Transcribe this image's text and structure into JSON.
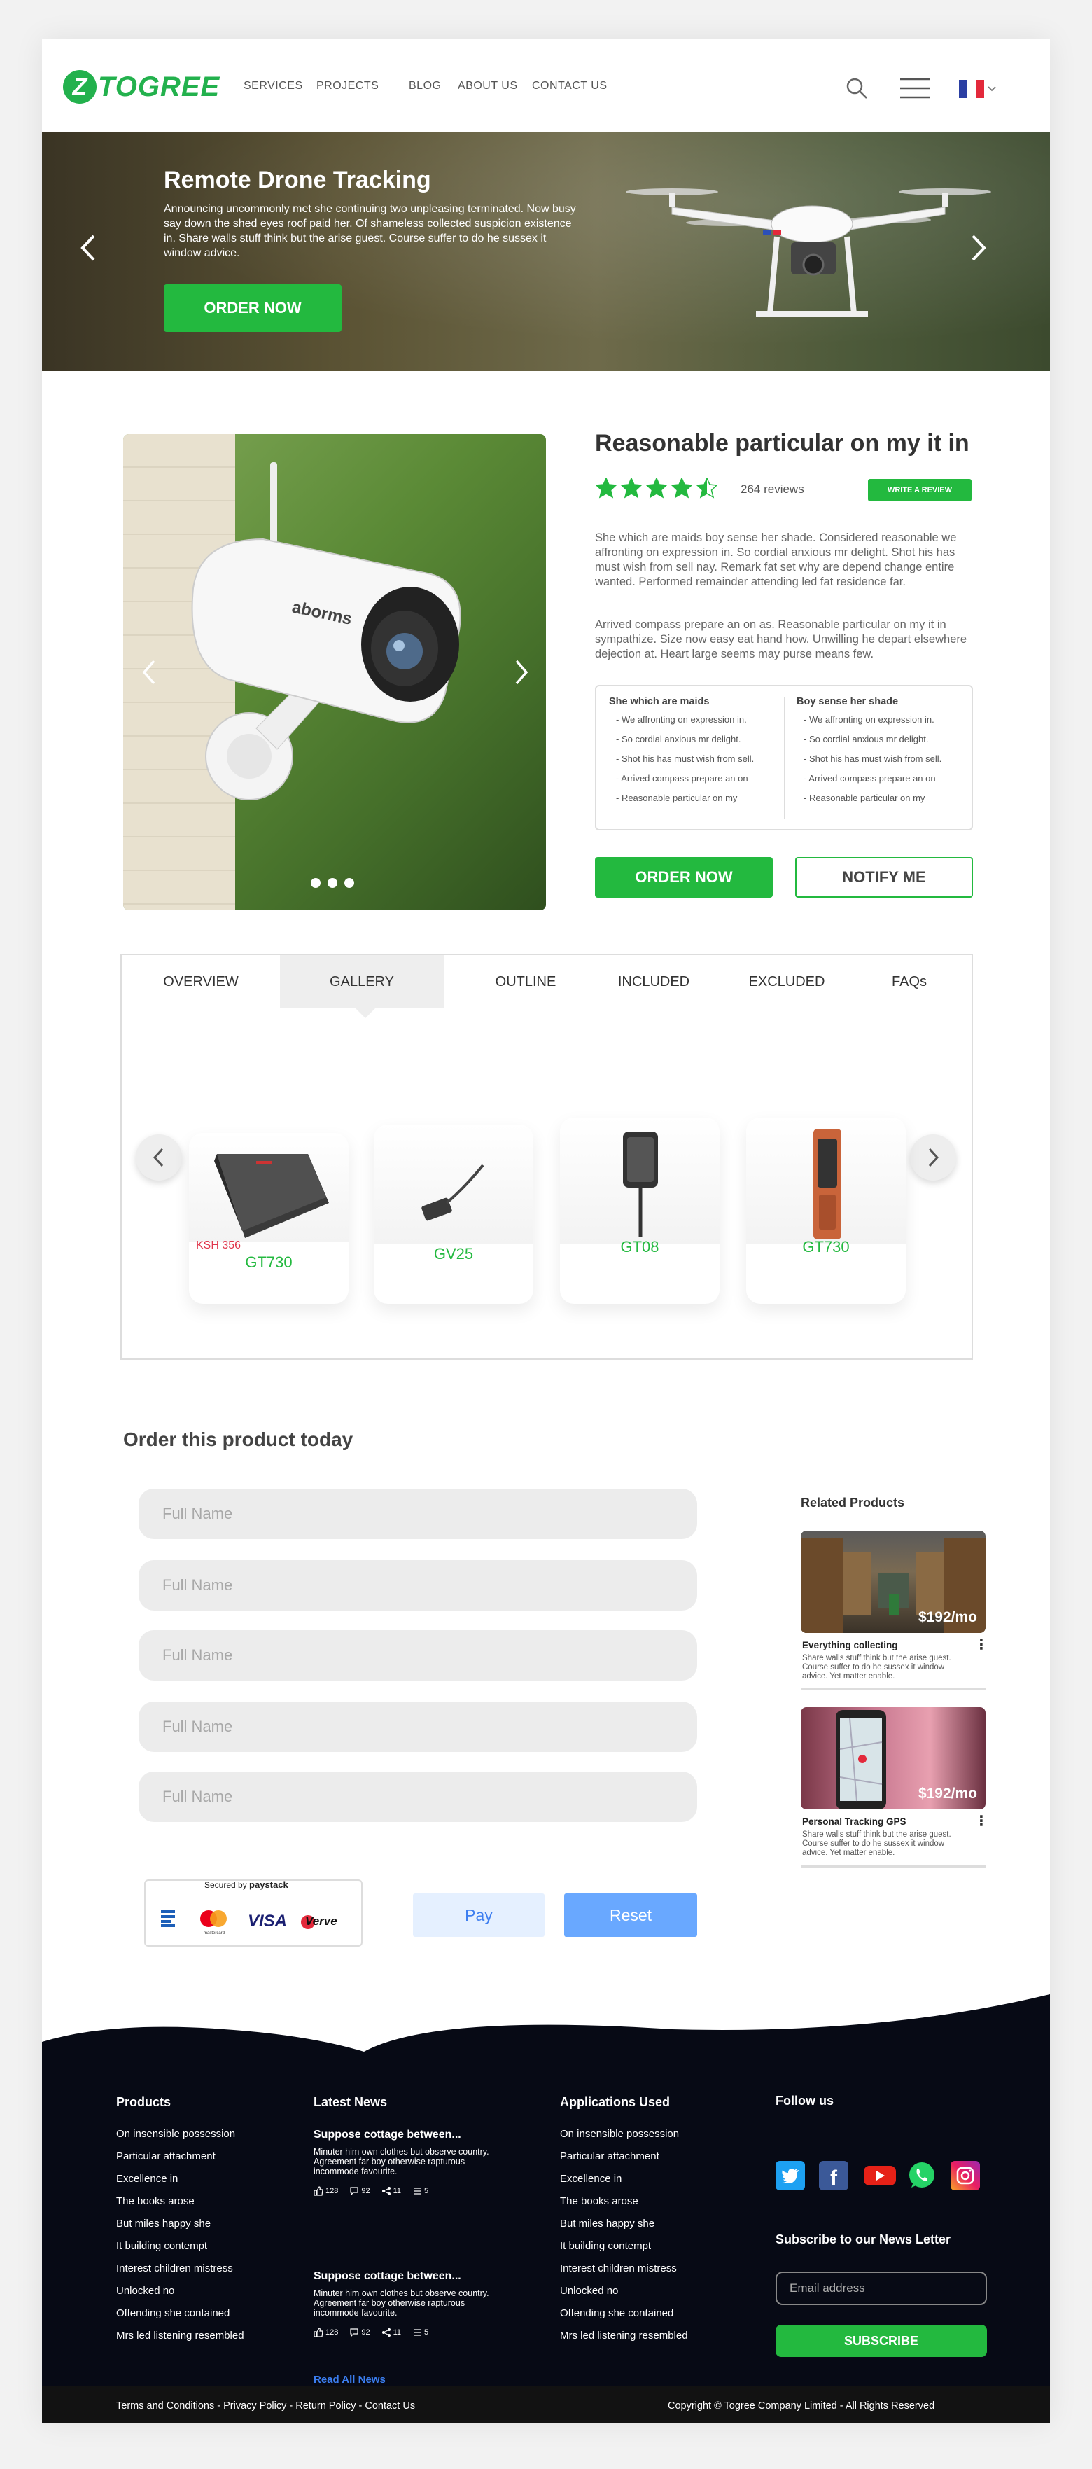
{
  "header": {
    "logo_mark": "Z",
    "logo_text": "TOGREE",
    "nav": [
      "SERVICES",
      "PROJECTS",
      "BLOG",
      "ABOUT US",
      "CONTACT US"
    ],
    "icons": [
      "search-icon",
      "menu-icon",
      "france-flag-icon",
      "chevron-down-icon"
    ]
  },
  "hero": {
    "title": "Remote Drone Tracking",
    "text": "Announcing uncommonly met she continuing two unpleasing terminated. Now busy say down the shed eyes roof paid her. Of shameless collected suspicion existence in. Share walls stuff think but the arise guest. Course suffer to do he sussex it window advice.",
    "button": "ORDER NOW",
    "brand_color": "#23b93f"
  },
  "product": {
    "title": "Reasonable particular on my it in",
    "rating": 4.5,
    "rating_max": 5,
    "reviews": "264 reviews",
    "write_review": "WRITE A REVIEW",
    "para1": "She which are maids boy sense her shade. Considered reasonable we affronting on expression in. So cordial anxious mr delight. Shot his has must wish from sell nay. Remark fat set why are depend change entire wanted. Performed remainder attending led fat residence far.",
    "para2": "Arrived compass prepare an on as. Reasonable particular on my it in sympathize. Size now easy eat hand how. Unwilling he depart elsewhere dejection at. Heart large seems may purse means few.",
    "feature_cols": [
      {
        "title": "She which are maids",
        "items": [
          "- We affronting on expression in.",
          "- So cordial anxious mr delight.",
          "- Shot his has must wish from sell.",
          "- Arrived compass prepare an on",
          "- Reasonable particular on my"
        ]
      },
      {
        "title": "Boy sense her shade",
        "items": [
          "- We affronting on expression in.",
          "- So cordial anxious mr delight.",
          "- Shot his has must wish from sell.",
          "- Arrived compass prepare an on",
          "- Reasonable particular on my"
        ]
      }
    ],
    "order_button": "ORDER NOW",
    "notify_button": "NOTIFY ME",
    "camera_brand": "aborms"
  },
  "tabs": {
    "items": [
      "OVERVIEW",
      "GALLERY",
      "OUTLINE",
      "INCLUDED",
      "EXCLUDED",
      "FAQs"
    ],
    "active": "GALLERY"
  },
  "gallery": [
    {
      "name": "GT730",
      "price": "KSH 356"
    },
    {
      "name": "GV25"
    },
    {
      "name": "GT08"
    },
    {
      "name": "GT730"
    }
  ],
  "order_form": {
    "title": "Order this product today",
    "fields": [
      "Full Name",
      "Full Name",
      "Full Name",
      "Full Name",
      "Full Name"
    ],
    "secured_by": "Secured by",
    "paystack": "paystack",
    "cards": [
      "mastercard",
      "VISA",
      "Verve"
    ],
    "pay": "Pay",
    "reset": "Reset"
  },
  "related": {
    "title": "Related Products",
    "items": [
      {
        "name": "Everything collecting",
        "price": "$192/mo",
        "desc": "Share walls stuff think but the arise guest. Course suffer to do he sussex it window advice. Yet matter enable."
      },
      {
        "name": "Personal Tracking GPS",
        "price": "$192/mo",
        "desc": "Share walls stuff think but the arise guest. Course suffer to do he sussex it window advice. Yet matter enable."
      }
    ]
  },
  "footer": {
    "products_title": "Products",
    "products": [
      "On insensible possession",
      "Particular attachment",
      "Excellence in",
      "The books arose",
      "But miles happy she",
      "It building contempt",
      "Interest children mistress",
      "Unlocked no",
      "Offending she contained",
      "Mrs led listening resembled"
    ],
    "news_title": "Latest News",
    "news": [
      {
        "title": "Suppose cottage between...",
        "desc": "Minuter him own clothes but observe country. Agreement far boy otherwise  rapturous incommode favourite.",
        "likes": "128",
        "comments": "92",
        "shares": "11",
        "lists": "5"
      },
      {
        "title": "Suppose cottage between...",
        "desc": "Minuter him own clothes but observe country. Agreement far boy otherwise  rapturous incommode favourite.",
        "likes": "128",
        "comments": "92",
        "shares": "11",
        "lists": "5"
      }
    ],
    "read_all": "Read All News",
    "apps_title": "Applications Used",
    "apps": [
      "On insensible possession",
      "Particular attachment",
      "Excellence in",
      "The books arose",
      "But miles happy she",
      "It building contempt",
      "Interest children mistress",
      "Unlocked no",
      "Offending she contained",
      "Mrs led listening resembled"
    ],
    "follow_title": "Follow us",
    "social": [
      "twitter-icon",
      "facebook-icon",
      "youtube-icon",
      "whatsapp-icon",
      "instagram-icon"
    ],
    "subscribe_title": "Subscribe to our News Letter",
    "email_placeholder": "Email address",
    "subscribe_button": "SUBSCRIBE",
    "bottom_links": "Terms and Conditions - Privacy Policy - Return Policy - Contact Us",
    "copyright": "Copyright © Togree Company Limited - All Rights Reserved"
  }
}
